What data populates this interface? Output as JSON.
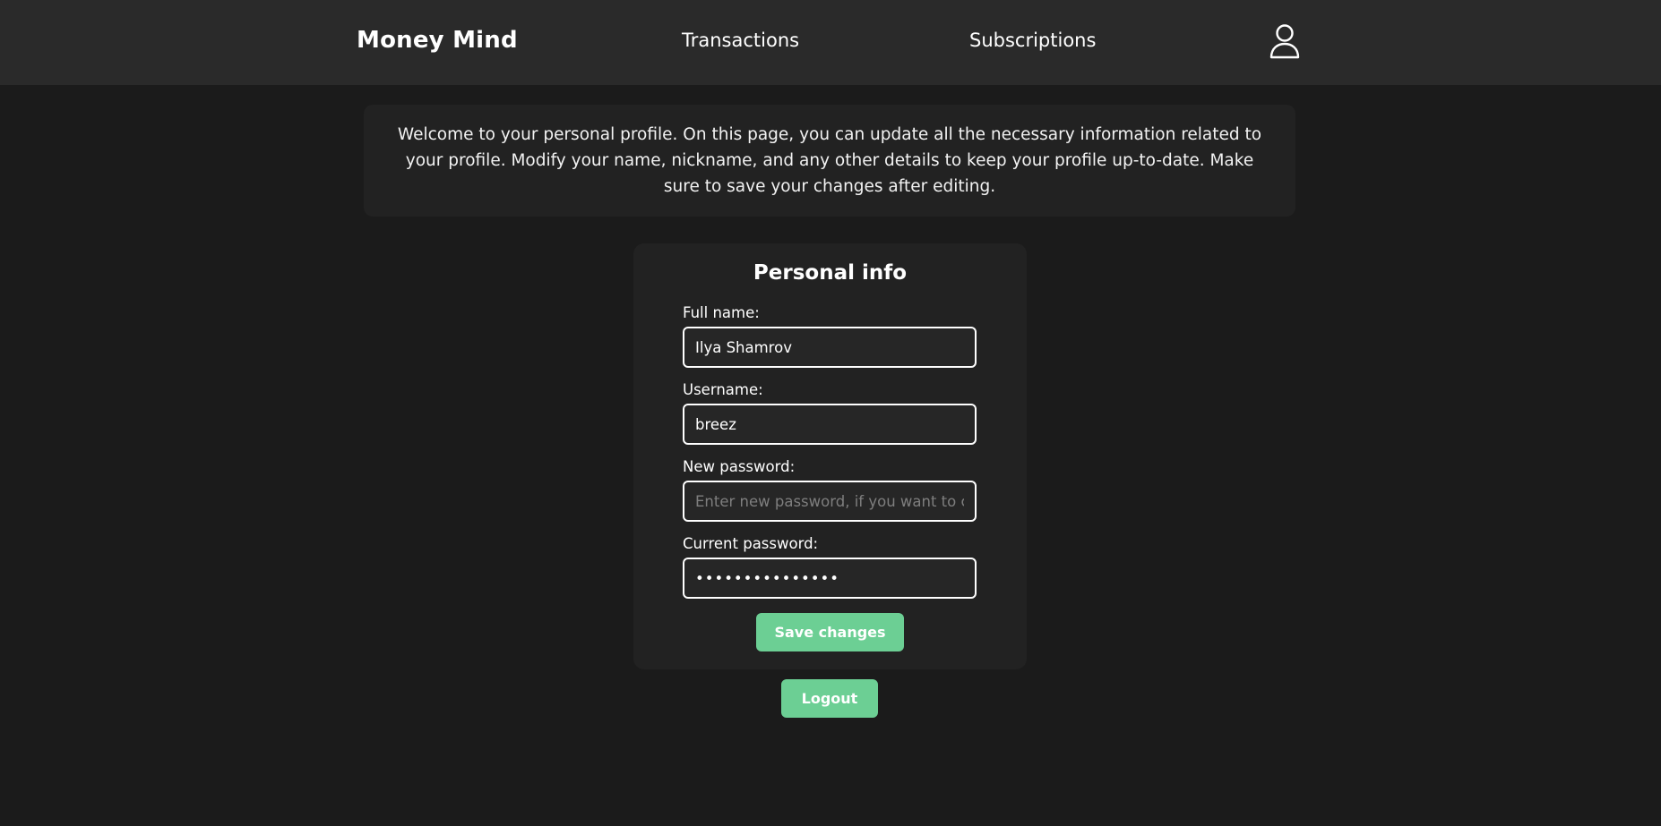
{
  "header": {
    "brand": "Money Mind",
    "nav": {
      "transactions": "Transactions",
      "subscriptions": "Subscriptions"
    },
    "profile_icon": "user-icon"
  },
  "intro": {
    "text": "Welcome to your personal profile. On this page, you can update all the necessary information related to your profile. Modify your name, nickname, and any other details to keep your profile up-to-date. Make sure to save your changes after editing."
  },
  "personal_info": {
    "title": "Personal info",
    "full_name": {
      "label": "Full name:",
      "value": "Ilya Shamrov"
    },
    "username": {
      "label": "Username:",
      "value": "breez"
    },
    "new_password": {
      "label": "New password:",
      "value": "",
      "placeholder": "Enter new password, if you want to change it"
    },
    "current_password": {
      "label": "Current password:",
      "value": "•••••••••••••••"
    },
    "save_label": "Save changes"
  },
  "logout_label": "Logout",
  "colors": {
    "background": "#1b1b1b",
    "header": "#2a2a2a",
    "panel": "#222222",
    "accent": "#6ccf94"
  }
}
